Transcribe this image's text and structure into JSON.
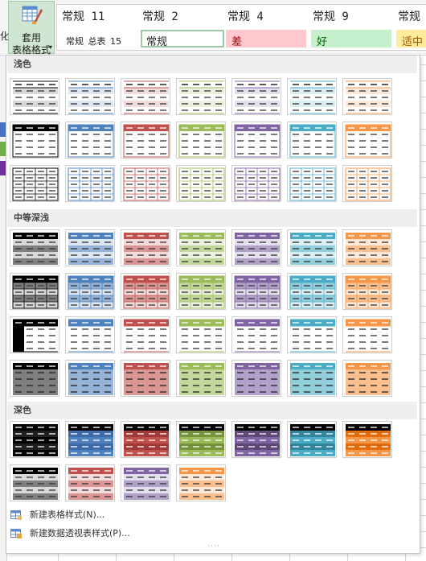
{
  "ribbon": {
    "clipped_left_char": "化",
    "format_button": {
      "line1": "套用",
      "line2": "表格格式",
      "arrow": "▾",
      "icon": "table-format-icon"
    },
    "cell_styles": [
      {
        "name": "常规 11",
        "value": "常规_总表_15",
        "bg": "#ffffff",
        "border": "#ffffff",
        "color": "#222222"
      },
      {
        "name": "常规 2",
        "value": "常规",
        "bg": "#ffffff",
        "border": "#9ccaa6",
        "color": "#222222"
      },
      {
        "name": "常规 4",
        "value": "差",
        "bg": "#ffc7ce",
        "border": "#ffc7ce",
        "color": "#9c0006"
      },
      {
        "name": "常规 9",
        "value": "好",
        "bg": "#c6efce",
        "border": "#c6efce",
        "color": "#006100"
      },
      {
        "name": "常规",
        "value": "适中",
        "bg": "#ffeb9c",
        "border": "#ffeb9c",
        "color": "#9c5700"
      }
    ]
  },
  "gallery": {
    "sections": [
      {
        "title": "浅色",
        "rows": [
          [
            "light-plain",
            "light-plain",
            "light-plain",
            "light-plain",
            "light-plain",
            "light-plain",
            "light-plain"
          ],
          [
            "light-header",
            "light-header",
            "light-header",
            "light-header",
            "light-header",
            "light-header",
            "light-header"
          ],
          [
            "light-grid",
            "light-grid",
            "light-grid",
            "light-grid",
            "light-grid",
            "light-grid",
            "light-grid"
          ]
        ]
      },
      {
        "title": "中等深浅",
        "rows": [
          [
            "medium-band",
            "medium-band",
            "medium-band",
            "medium-band",
            "medium-band",
            "medium-band",
            "medium-band"
          ],
          [
            "medium-grid",
            "medium-grid",
            "medium-grid",
            "medium-grid",
            "medium-grid",
            "medium-grid",
            "medium-grid"
          ],
          [
            "medium-first-col",
            "medium-header-line",
            "medium-header-line",
            "medium-header-line",
            "medium-header-line",
            "medium-header-line",
            "medium-header-line"
          ],
          [
            "medium-full",
            "medium-full",
            "medium-full",
            "medium-full",
            "medium-full",
            "medium-full",
            "medium-full"
          ]
        ]
      },
      {
        "title": "深色",
        "rows": [
          [
            "dark-full",
            "dark-full",
            "dark-full",
            "dark-full",
            "dark-full",
            "dark-full",
            "dark-full"
          ],
          [
            "dark-light-band",
            "dark-light-band",
            "dark-light-band",
            "dark-light-band"
          ]
        ]
      }
    ],
    "palette": [
      {
        "dark": "#1f1f1f",
        "mid": "#7f7f7f",
        "light": "#d9d9d9",
        "header_light": "#000000"
      },
      {
        "dark": "#3e6aa8",
        "mid": "#95b3d7",
        "light": "#dce6f1",
        "header_light": "#4f81bd"
      },
      {
        "dark": "#a33a38",
        "mid": "#da9694",
        "light": "#f2dcdb",
        "header_light": "#c0504d"
      },
      {
        "dark": "#76933c",
        "mid": "#c4d79b",
        "light": "#ebf1de",
        "header_light": "#9bbb59"
      },
      {
        "dark": "#5f497a",
        "mid": "#b1a0c7",
        "light": "#e4dfec",
        "header_light": "#8064a2"
      },
      {
        "dark": "#31869b",
        "mid": "#92cddc",
        "light": "#daeef3",
        "header_light": "#4bacc6"
      },
      {
        "dark": "#e26b0a",
        "mid": "#fabf8f",
        "light": "#fde9d9",
        "header_light": "#f79646"
      }
    ],
    "dark_row2_palette_index": [
      0,
      2,
      4,
      6
    ],
    "commands": [
      {
        "label": "新建表格样式(N)...",
        "icon": "new-table-style-icon"
      },
      {
        "label": "新建数据透视表样式(P)...",
        "icon": "new-pivot-style-icon"
      }
    ],
    "grip": "····"
  }
}
